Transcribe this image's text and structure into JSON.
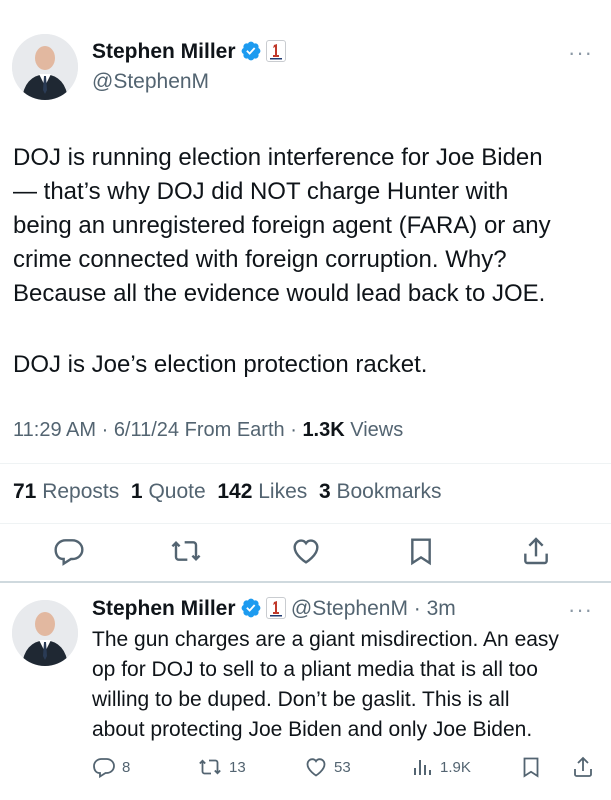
{
  "main_tweet": {
    "author_name": "Stephen Miller",
    "author_handle": "@StephenM",
    "more_glyph": "···",
    "text_p1": "DOJ is running election interference for Joe Biden\n— that’s why DOJ did NOT charge Hunter with\nbeing an unregistered foreign agent (FARA) or any\ncrime connected with foreign corruption. Why?\nBecause all the evidence would lead back to JOE.",
    "text_p2": "DOJ is Joe’s election protection racket.",
    "time": "11:29 AM",
    "date": "6/11/24",
    "source": "From Earth",
    "views_count": "1.3K",
    "views_label": "Views",
    "reposts_count": "71",
    "reposts_label": "Reposts",
    "quotes_count": "1",
    "quotes_label": "Quote",
    "likes_count": "142",
    "likes_label": "Likes",
    "bookmarks_count": "3",
    "bookmarks_label": "Bookmarks"
  },
  "reply_tweet": {
    "author_name": "Stephen Miller",
    "author_handle": "@StephenM",
    "time_ago": "3m",
    "more_glyph": "···",
    "text": "The gun charges are a giant misdirection. An easy\nop for DOJ to sell to a pliant media that is all too\nwilling to be duped. Don’t be gaslit. This is all\nabout protecting Joe Biden and only Joe Biden.",
    "replies": "8",
    "reposts": "13",
    "likes": "53",
    "views": "1.9K"
  },
  "colors": {
    "verified_blue": "#1d9bf0",
    "text_secondary": "#536471",
    "text_primary": "#0f1419"
  },
  "icons": [
    "reply-icon",
    "repost-icon",
    "like-icon",
    "bookmark-icon",
    "share-icon",
    "views-icon",
    "verified-icon"
  ]
}
